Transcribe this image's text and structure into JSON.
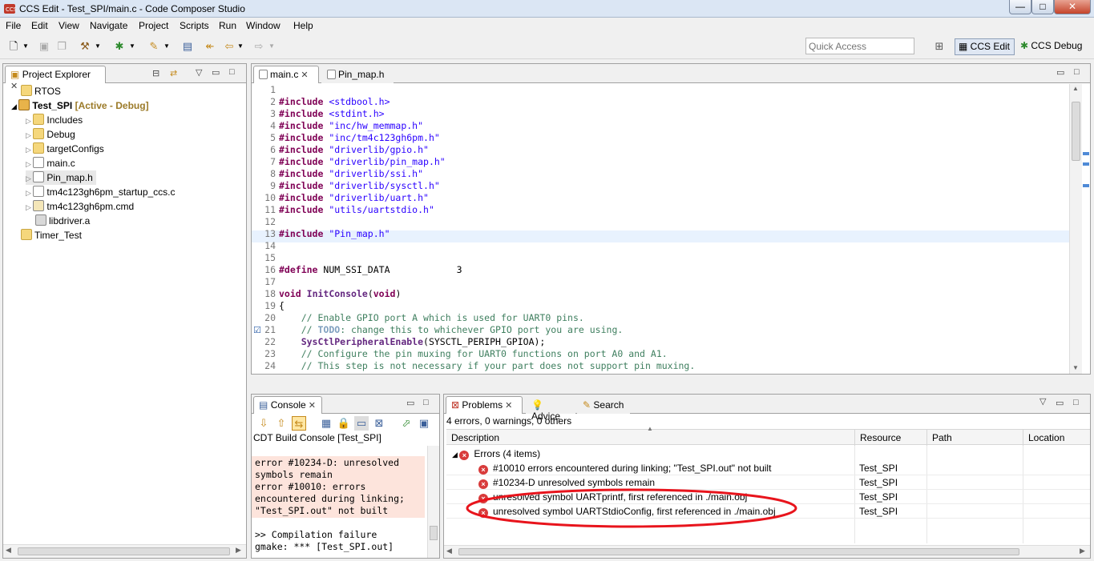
{
  "window": {
    "title": "CCS Edit - Test_SPI/main.c - Code Composer Studio",
    "min": "—",
    "max": "□",
    "close": "✕"
  },
  "menus": [
    "File",
    "Edit",
    "View",
    "Navigate",
    "Project",
    "Scripts",
    "Run",
    "Window",
    "Help"
  ],
  "toolbar": {
    "quick_access_placeholder": "Quick Access",
    "persp_edit": "CCS Edit",
    "persp_debug": "CCS Debug"
  },
  "project_explorer": {
    "tab": "Project Explorer",
    "items": [
      {
        "label": "RTOS",
        "suffix": ""
      },
      {
        "label": "Test_SPI",
        "suffix": " [Active - Debug]"
      },
      {
        "label": "Includes",
        "suffix": ""
      },
      {
        "label": "Debug",
        "suffix": ""
      },
      {
        "label": "targetConfigs",
        "suffix": ""
      },
      {
        "label": "main.c",
        "suffix": ""
      },
      {
        "label": "Pin_map.h",
        "suffix": ""
      },
      {
        "label": "tm4c123gh6pm_startup_ccs.c",
        "suffix": ""
      },
      {
        "label": "tm4c123gh6pm.cmd",
        "suffix": ""
      },
      {
        "label": "libdriver.a",
        "suffix": ""
      },
      {
        "label": "Timer_Test",
        "suffix": ""
      }
    ]
  },
  "editor": {
    "tabs": [
      "main.c",
      "Pin_map.h"
    ],
    "lines": [
      {
        "n": "1",
        "parts": []
      },
      {
        "n": "2",
        "parts": [
          [
            "kw",
            "#include"
          ],
          [
            "",
            ""
          ],
          [
            "str",
            "<stdbool.h>"
          ]
        ]
      },
      {
        "n": "3",
        "parts": [
          [
            "kw",
            "#include"
          ],
          [
            "",
            ""
          ],
          [
            "str",
            "<stdint.h>"
          ]
        ]
      },
      {
        "n": "4",
        "parts": [
          [
            "kw",
            "#include"
          ],
          [
            "",
            ""
          ],
          [
            "str",
            "\"inc/hw_memmap.h\""
          ]
        ]
      },
      {
        "n": "5",
        "parts": [
          [
            "kw",
            "#include"
          ],
          [
            "",
            ""
          ],
          [
            "str",
            "\"inc/tm4c123gh6pm.h\""
          ]
        ]
      },
      {
        "n": "6",
        "parts": [
          [
            "kw",
            "#include"
          ],
          [
            "",
            ""
          ],
          [
            "str",
            "\"driverlib/gpio.h\""
          ]
        ]
      },
      {
        "n": "7",
        "parts": [
          [
            "kw",
            "#include"
          ],
          [
            "",
            ""
          ],
          [
            "str",
            "\"driverlib/pin_map.h\""
          ]
        ]
      },
      {
        "n": "8",
        "parts": [
          [
            "kw",
            "#include"
          ],
          [
            "",
            ""
          ],
          [
            "str",
            "\"driverlib/ssi.h\""
          ]
        ]
      },
      {
        "n": "9",
        "parts": [
          [
            "kw",
            "#include"
          ],
          [
            "",
            ""
          ],
          [
            "str",
            "\"driverlib/sysctl.h\""
          ]
        ]
      },
      {
        "n": "10",
        "parts": [
          [
            "kw",
            "#include"
          ],
          [
            "",
            ""
          ],
          [
            "str",
            "\"driverlib/uart.h\""
          ]
        ]
      },
      {
        "n": "11",
        "parts": [
          [
            "kw",
            "#include"
          ],
          [
            "",
            ""
          ],
          [
            "str",
            "\"utils/uartstdio.h\""
          ]
        ]
      },
      {
        "n": "12",
        "parts": []
      },
      {
        "n": "13",
        "parts": [
          [
            "kw",
            "#include"
          ],
          [
            "",
            ""
          ],
          [
            "str",
            "\"Pin_map.h\""
          ]
        ]
      },
      {
        "n": "14",
        "parts": []
      },
      {
        "n": "15",
        "parts": []
      },
      {
        "n": "16",
        "parts": [
          [
            "kw",
            "#define"
          ],
          [
            "",
            ""
          ],
          [
            "",
            "NUM_SSI_DATA            3"
          ]
        ]
      },
      {
        "n": "17",
        "parts": []
      },
      {
        "n": "18",
        "parts": [
          [
            "kw",
            "void"
          ],
          [
            "",
            ""
          ],
          [
            "fn",
            "InitConsole"
          ],
          [
            "",
            "("
          ],
          [
            "kw",
            "void"
          ],
          [
            "",
            ")"
          ]
        ]
      },
      {
        "n": "19",
        "parts": [
          [
            "",
            "{"
          ]
        ]
      },
      {
        "n": "20",
        "parts": [
          [
            "",
            "    "
          ],
          [
            "cmt",
            "// Enable GPIO port A which is used for UART0 pins."
          ]
        ]
      },
      {
        "n": "21",
        "parts": [
          [
            "",
            "    "
          ],
          [
            "cmt",
            "// "
          ],
          [
            "todo",
            "TODO"
          ],
          [
            "cmt",
            ": change this to whichever GPIO port you are using."
          ]
        ]
      },
      {
        "n": "22",
        "parts": [
          [
            "",
            "    "
          ],
          [
            "fn",
            "SysCtlPeripheralEnable"
          ],
          [
            "",
            "(SYSCTL_PERIPH_GPIOA);"
          ]
        ]
      },
      {
        "n": "23",
        "parts": [
          [
            "",
            "    "
          ],
          [
            "cmt",
            "// Configure the pin muxing for UART0 functions on port A0 and A1."
          ]
        ]
      },
      {
        "n": "24",
        "parts": [
          [
            "",
            "    "
          ],
          [
            "cmt",
            "// This step is not necessary if your part does not support pin muxing."
          ]
        ]
      }
    ]
  },
  "console": {
    "tab": "Console",
    "header": "CDT Build Console [Test_SPI]",
    "lines": [
      "error #10234-D: unresolved",
      "symbols remain",
      "error #10010: errors",
      "encountered during linking;",
      "\"Test_SPI.out\" not built",
      "",
      ">> Compilation failure",
      "gmake: *** [Test_SPI.out]"
    ]
  },
  "problems": {
    "tabs": [
      "Problems",
      "Advice",
      "Search"
    ],
    "summary": "4 errors, 0 warnings, 0 others",
    "columns": [
      "Description",
      "Resource",
      "Path",
      "Location"
    ],
    "group": "Errors (4 items)",
    "rows": [
      {
        "desc": "#10010 errors encountered during linking; \"Test_SPI.out\" not built",
        "res": "Test_SPI"
      },
      {
        "desc": "#10234-D unresolved symbols remain",
        "res": "Test_SPI"
      },
      {
        "desc": "unresolved symbol UARTprintf, first referenced in ./main.obj",
        "res": "Test_SPI"
      },
      {
        "desc": "unresolved symbol UARTStdioConfig, first referenced in ./main.obj",
        "res": "Test_SPI"
      }
    ]
  },
  "colors": {
    "highlight_ellipse": "#e8141c",
    "console_error_bg": "#fde4dc"
  }
}
